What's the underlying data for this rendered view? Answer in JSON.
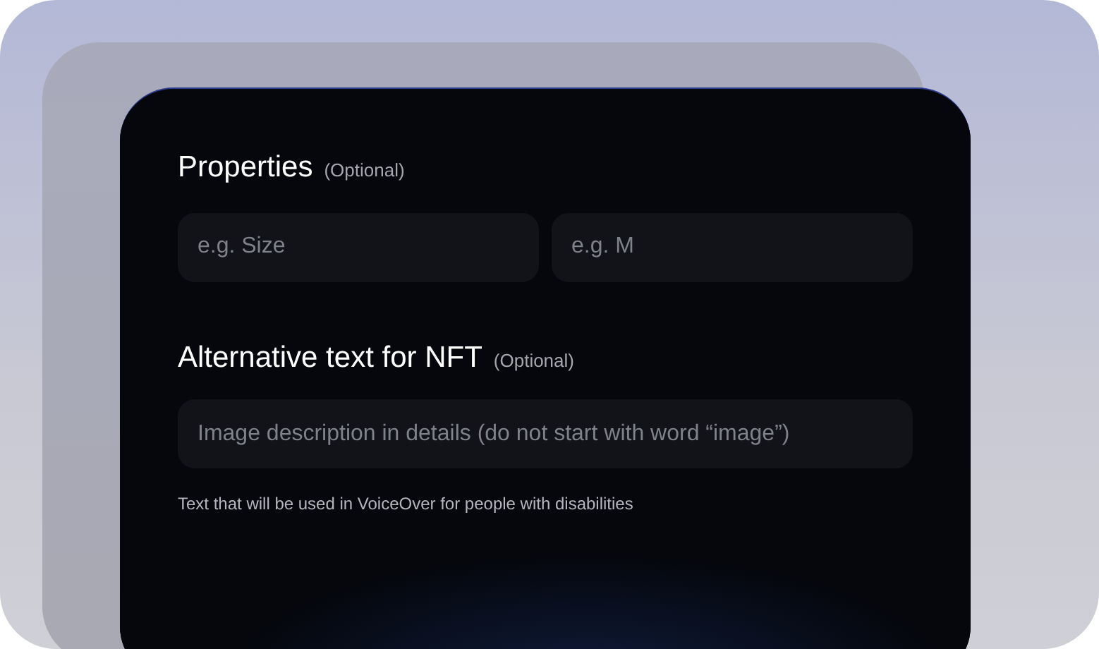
{
  "properties": {
    "title": "Properties",
    "hint": "(Optional)",
    "fields": [
      {
        "placeholder": "e.g. Size"
      },
      {
        "placeholder": "e.g. M"
      }
    ]
  },
  "alt_text": {
    "title": "Alternative text for NFT",
    "hint": "(Optional)",
    "field": {
      "placeholder": "Image description in details (do not start with word “image”)"
    },
    "help": "Text that will be used in VoiceOver for people with disabilities"
  }
}
